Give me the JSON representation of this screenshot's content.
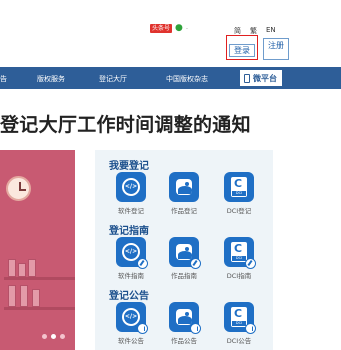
{
  "header": {
    "social": {
      "weibo_label": "头条号",
      "wechat_icon": "wechat-icon",
      "trailing": "·"
    },
    "languages": [
      "简",
      "繁",
      "EN"
    ],
    "login_label": "登录",
    "register_label": "注册"
  },
  "nav": {
    "items": [
      "告",
      "版权服务",
      "登记大厅",
      "中国版权杂志"
    ],
    "platform_label": "微平台"
  },
  "headline": "登记大厅工作时间调整的通知",
  "services": {
    "sections": [
      {
        "title": "我要登记",
        "items": [
          {
            "label": "软件登记",
            "icon": "code-icon"
          },
          {
            "label": "作品登记",
            "icon": "photo-icon"
          },
          {
            "label": "DCI登记",
            "icon": "dci-icon"
          }
        ]
      },
      {
        "title": "登记指南",
        "items": [
          {
            "label": "软件指南",
            "icon": "code-guide-icon"
          },
          {
            "label": "作品指南",
            "icon": "photo-guide-icon"
          },
          {
            "label": "DCI指南",
            "icon": "dci-guide-icon"
          }
        ]
      },
      {
        "title": "登记公告",
        "items": [
          {
            "label": "软件公告",
            "icon": "code-notice-icon"
          },
          {
            "label": "作品公告",
            "icon": "photo-notice-icon"
          },
          {
            "label": "DCI公告",
            "icon": "dci-notice-icon"
          }
        ]
      }
    ]
  },
  "banner": {
    "dot_count": 3,
    "active_dot": 1
  },
  "colors": {
    "nav": "#2e5e98",
    "accent": "#1f6fc5",
    "highlight": "#e02020"
  }
}
